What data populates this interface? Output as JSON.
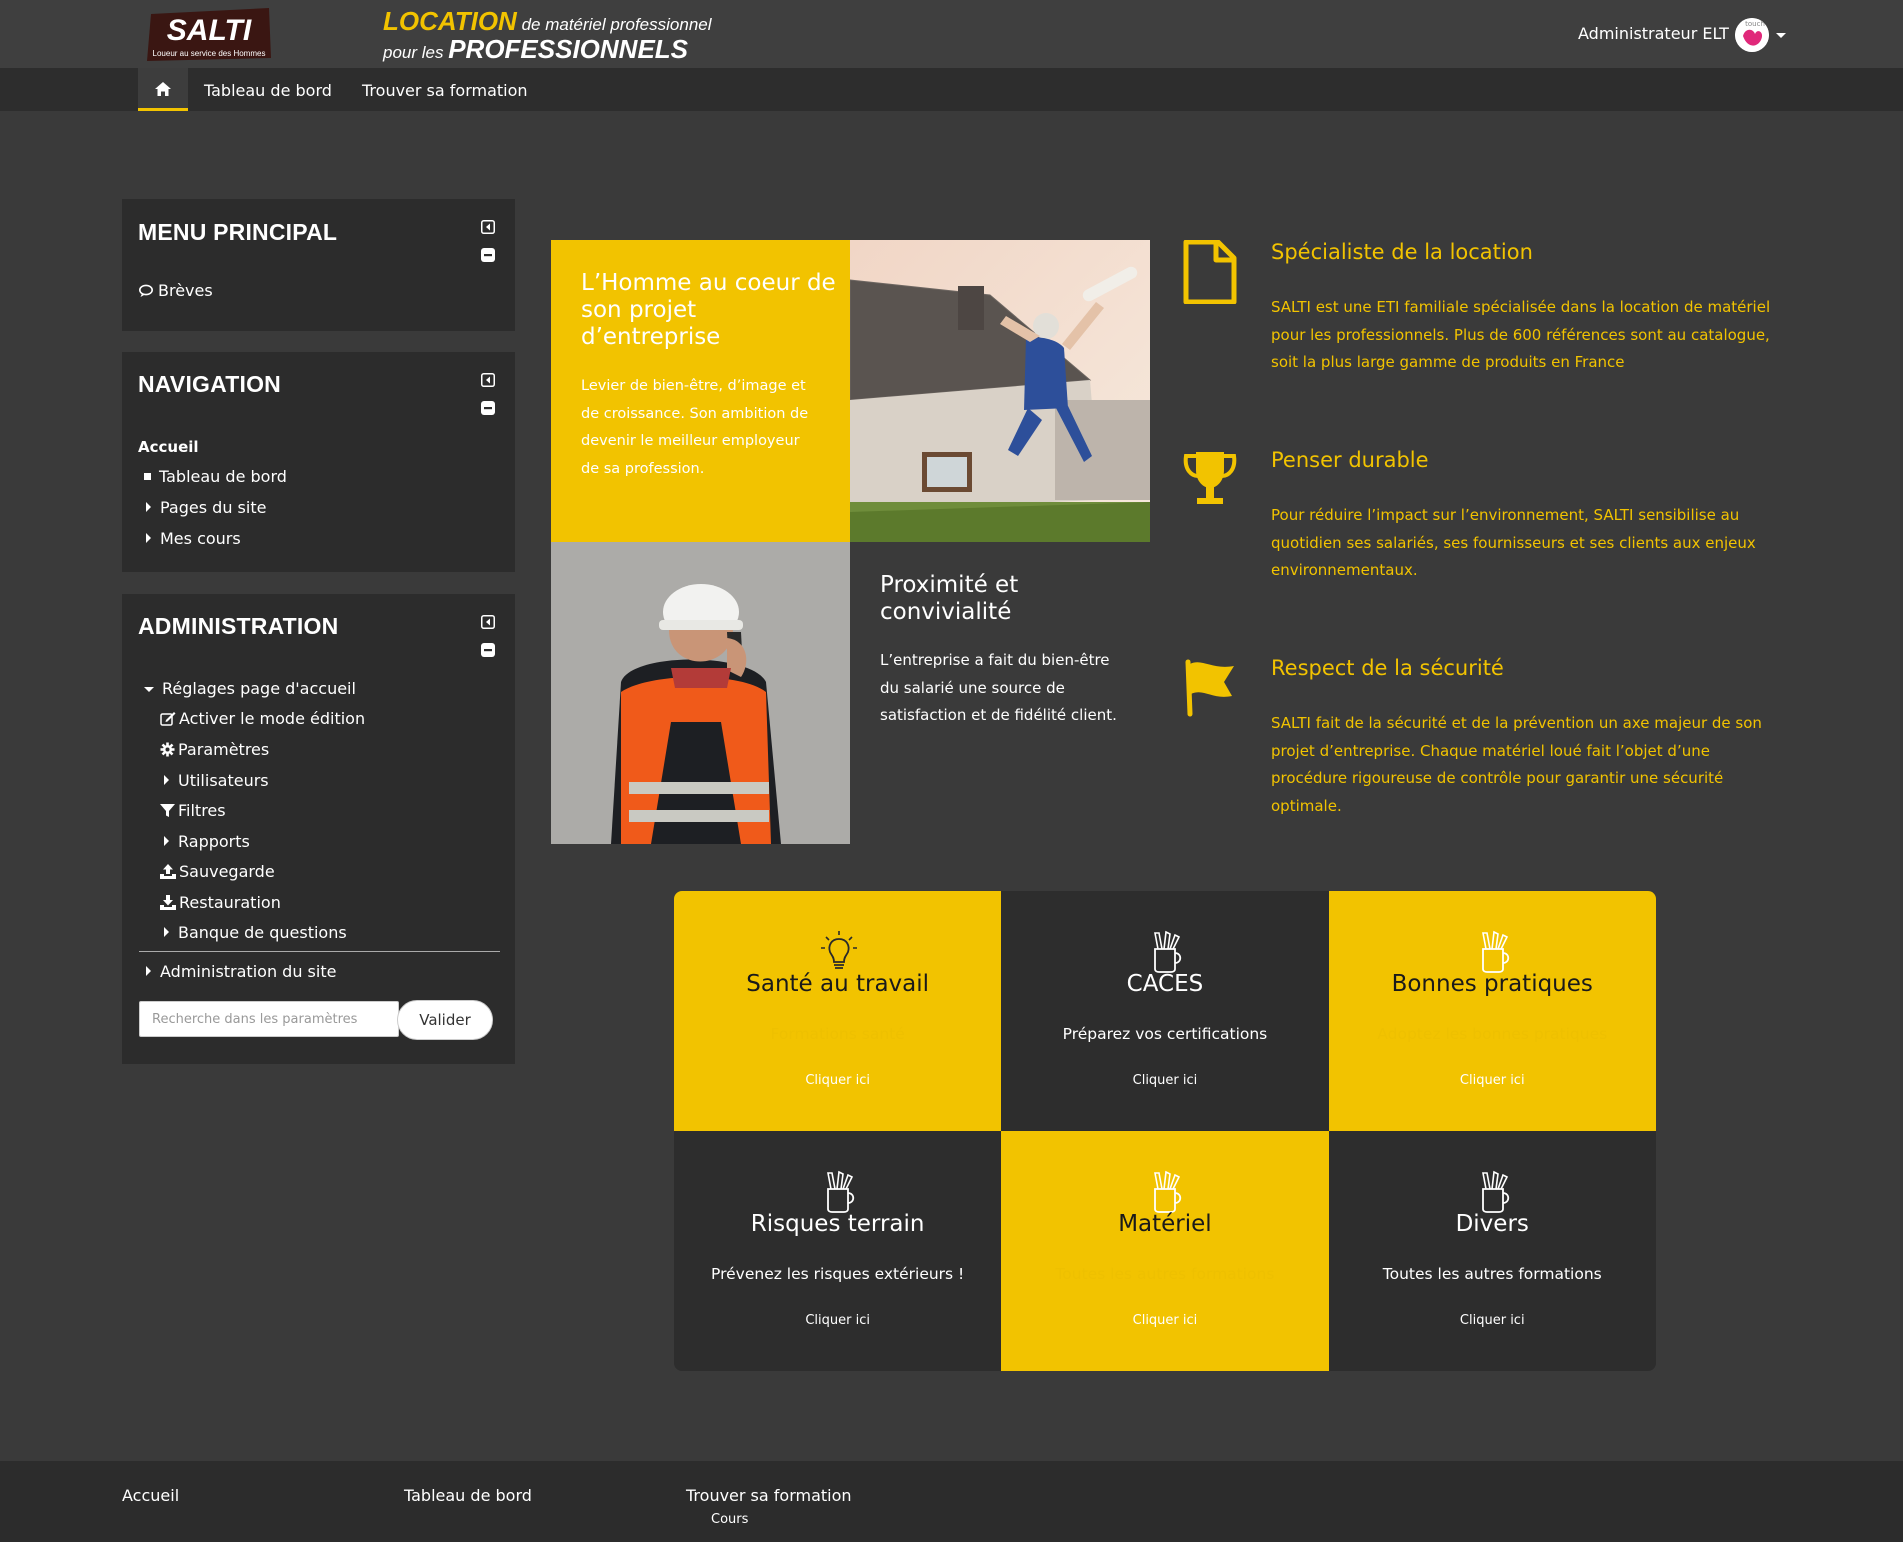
{
  "header": {
    "logo_text": "SALTI",
    "logo_tagline": "Loueur au service des Hommes",
    "slogan_word1": "LOCATION",
    "slogan_rest1": " de matériel professionnel",
    "slogan_pre2": "pour les ",
    "slogan_word2": "PROFESSIONNELS",
    "user_name": "Administrateur ELT",
    "avatar_text": "touch"
  },
  "nav": {
    "home_icon": "home-icon",
    "links": [
      "Tableau de bord",
      "Trouver sa formation"
    ]
  },
  "blocks": {
    "main_menu": {
      "title": "MENU PRINCIPAL",
      "items": [
        "Brèves"
      ]
    },
    "navigation": {
      "title": "NAVIGATION",
      "root": "Accueil",
      "items": [
        "Tableau de bord",
        "Pages du site",
        "Mes cours"
      ]
    },
    "administration": {
      "title": "ADMINISTRATION",
      "section": "Réglages page d'accueil",
      "items": [
        "Activer le mode édition",
        "Paramètres",
        "Utilisateurs",
        "Filtres",
        "Rapports",
        "Sauvegarde",
        "Restauration",
        "Banque de questions"
      ],
      "site_admin": "Administration du site",
      "search_placeholder": "Recherche dans les paramètres",
      "search_button": "Valider"
    }
  },
  "promo": {
    "card1_title": "L’Homme au coeur de son projet d’entreprise",
    "card1_text": "Levier de bien-être, d’image et de croissance. Son ambition de devenir le meilleur employeur de sa profession.",
    "card2_title": "Proximité et convivialité",
    "card2_text": "L’entreprise a fait du bien-être du salarié une source de satisfaction et de fidélité client."
  },
  "features": [
    {
      "icon": "document-icon",
      "title": "Spécialiste de la location",
      "text": "SALTI est une ETI familiale spécialisée dans la location de matériel pour les professionnels. Plus de 600 références sont au catalogue, soit la plus large gamme de produits en France"
    },
    {
      "icon": "trophy-icon",
      "title": "Penser durable",
      "text": "Pour réduire l’impact sur l’environnement, SALTI sensibilise au quotidien ses salariés, ses fournisseurs et ses clients aux enjeux environnementaux."
    },
    {
      "icon": "flag-icon",
      "title": "Respect de la sécurité",
      "text": "SALTI fait de la sécurité et de la prévention un axe majeur de son projet d’entreprise. Chaque matériel loué fait l’objet d’une procédure rigoureuse de contrôle pour garantir une sécurité optimale."
    }
  ],
  "tiles": [
    {
      "title": "Santé au travail",
      "subtitle": "Formations santé",
      "link": "Cliquer ici",
      "icon": "lightbulb-icon",
      "color": "yellow"
    },
    {
      "title": "CACES",
      "subtitle": "Préparez vos certifications",
      "link": "Cliquer ici",
      "icon": "pencil-cup-icon",
      "color": "dark"
    },
    {
      "title": "Bonnes pratiques",
      "subtitle": "Adoptez les bonnes pratiques",
      "link": "Cliquer ici",
      "icon": "pencil-cup-icon",
      "color": "yellow"
    },
    {
      "title": "Risques terrain",
      "subtitle": "Prévenez les risques extérieurs !",
      "link": "Cliquer ici",
      "icon": "pencil-cup-icon",
      "color": "dark"
    },
    {
      "title": "Matériel",
      "subtitle": "Toutes les autres formations",
      "link": "Cliquer ici",
      "icon": "pencil-cup-icon",
      "color": "yellow"
    },
    {
      "title": "Divers",
      "subtitle": "Toutes les autres formations",
      "link": "Cliquer ici",
      "icon": "pencil-cup-icon",
      "color": "dark"
    }
  ],
  "footer": {
    "col1": "Accueil",
    "col2": "Tableau de bord",
    "col3": "Trouver sa formation",
    "col3_sub": "Cours"
  },
  "colors": {
    "accent": "#f2c300",
    "background": "#3a3a3a",
    "block": "#2c2c2c",
    "dark_tile": "#2d2d2d"
  }
}
